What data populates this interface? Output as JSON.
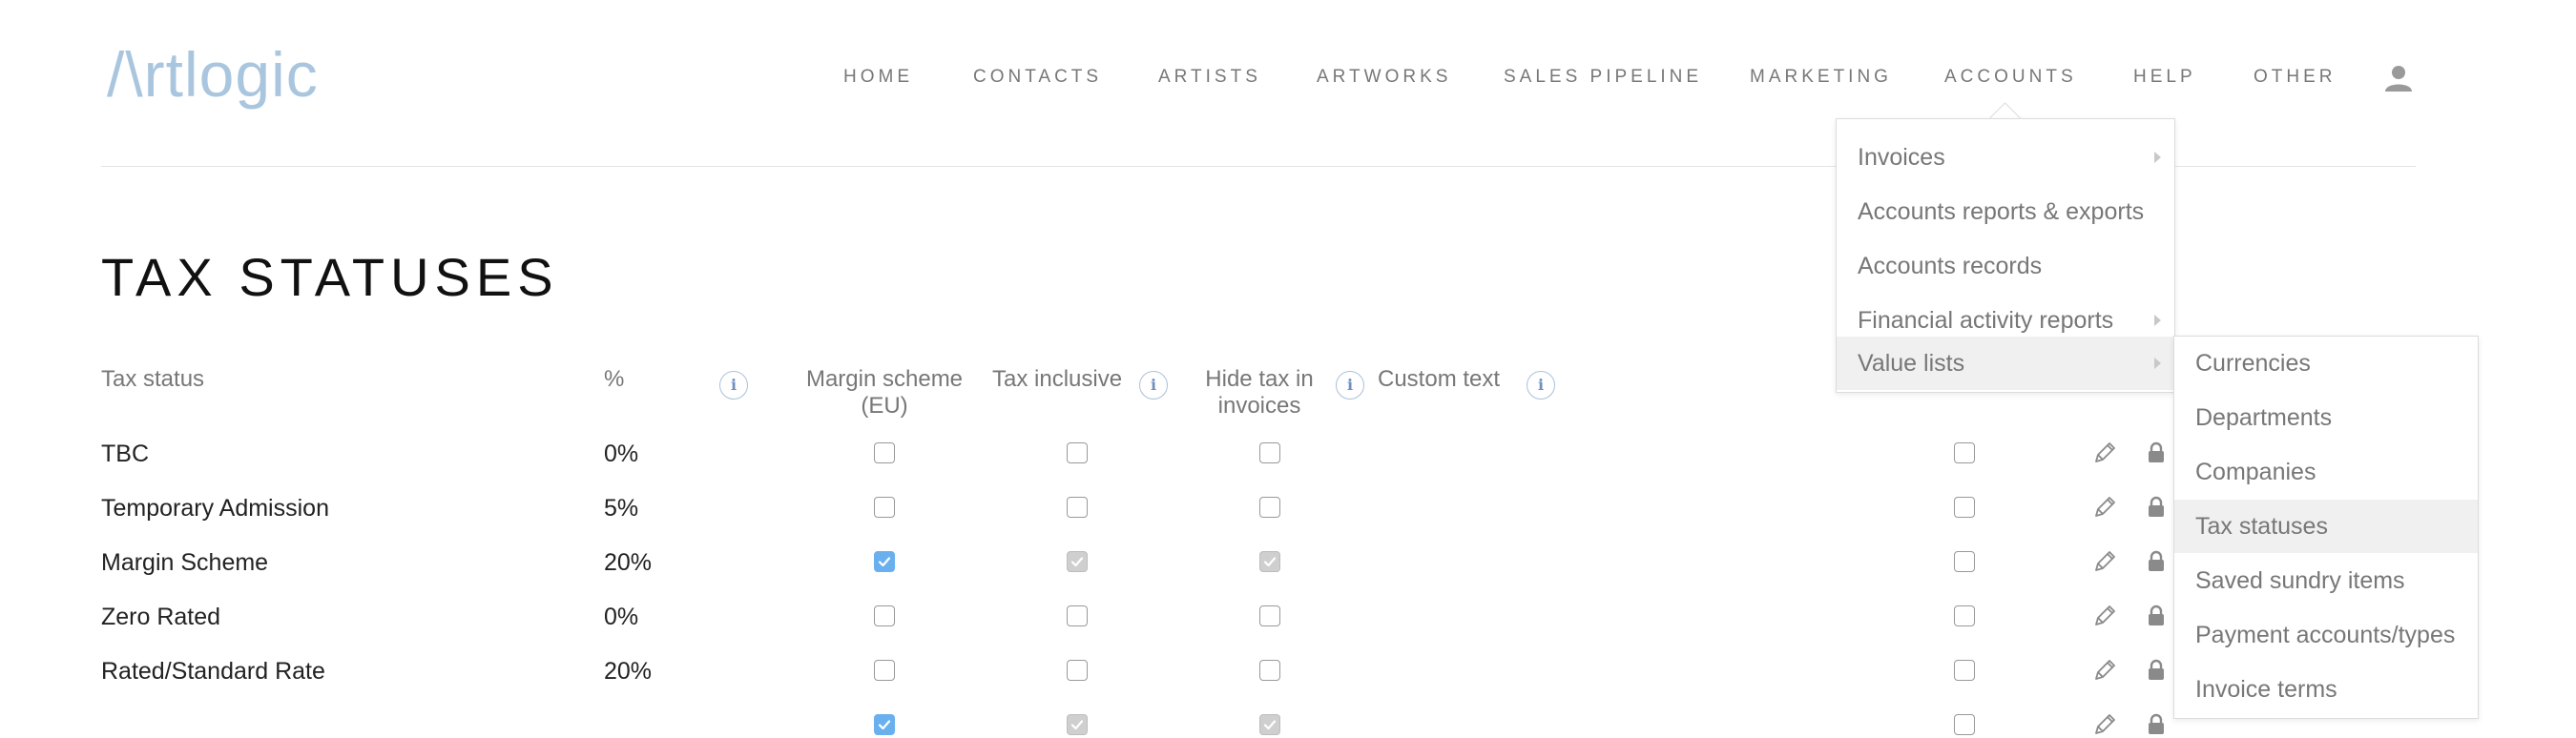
{
  "brand": {
    "logo_text": "/\\rtlogic",
    "logo_color": "#a9c6de"
  },
  "nav": {
    "items": [
      {
        "label": "HOME"
      },
      {
        "label": "CONTACTS"
      },
      {
        "label": "ARTISTS"
      },
      {
        "label": "ARTWORKS"
      },
      {
        "label": "SALES PIPELINE"
      },
      {
        "label": "MARKETING"
      },
      {
        "label": "ACCOUNTS"
      },
      {
        "label": "HELP"
      },
      {
        "label": "OTHER"
      }
    ],
    "user_icon": "user-icon"
  },
  "page": {
    "title": "TAX STATUSES"
  },
  "table": {
    "headers": {
      "tax_status": "Tax status",
      "percent": "%",
      "margin_scheme": "Margin scheme (EU)",
      "tax_inclusive": "Tax inclusive",
      "hide_tax": "Hide tax in invoices",
      "custom_text": "Custom text"
    },
    "info_icon_glyph": "i",
    "rows": [
      {
        "name": "TBC",
        "pct": "0%",
        "margin": "unchecked",
        "inclusive": "unchecked",
        "hide": "unchecked",
        "extra": "unchecked"
      },
      {
        "name": "Temporary Admission",
        "pct": "5%",
        "margin": "unchecked",
        "inclusive": "unchecked",
        "hide": "unchecked",
        "extra": "unchecked"
      },
      {
        "name": "Margin Scheme",
        "pct": "20%",
        "margin": "checked",
        "inclusive": "checked-disabled",
        "hide": "checked-disabled",
        "extra": "unchecked"
      },
      {
        "name": "Zero Rated",
        "pct": "0%",
        "margin": "unchecked",
        "inclusive": "unchecked",
        "hide": "unchecked",
        "extra": "unchecked"
      },
      {
        "name": "Rated/Standard Rate",
        "pct": "20%",
        "margin": "unchecked",
        "inclusive": "unchecked",
        "hide": "unchecked",
        "extra": "unchecked"
      },
      {
        "name": "",
        "pct": "",
        "margin": "checked",
        "inclusive": "checked-disabled",
        "hide": "checked-disabled",
        "extra": "unchecked"
      }
    ]
  },
  "accounts_menu": {
    "items": [
      {
        "label": "Invoices",
        "has_submenu": true
      },
      {
        "label": "Accounts reports & exports",
        "has_submenu": false
      },
      {
        "label": "Accounts records",
        "has_submenu": false
      },
      {
        "label": "Financial activity reports",
        "has_submenu": true
      },
      {
        "label": "Value lists",
        "has_submenu": true,
        "active": true
      }
    ]
  },
  "value_lists_submenu": {
    "items": [
      {
        "label": "Currencies"
      },
      {
        "label": "Departments"
      },
      {
        "label": "Companies"
      },
      {
        "label": "Tax statuses",
        "active": true
      },
      {
        "label": "Saved sundry items"
      },
      {
        "label": "Payment accounts/types"
      },
      {
        "label": "Invoice terms"
      }
    ]
  },
  "colors": {
    "accent_blue": "#6ab0ee",
    "disabled_grey": "#cfcfcf",
    "logo_blue": "#a9c6de"
  }
}
